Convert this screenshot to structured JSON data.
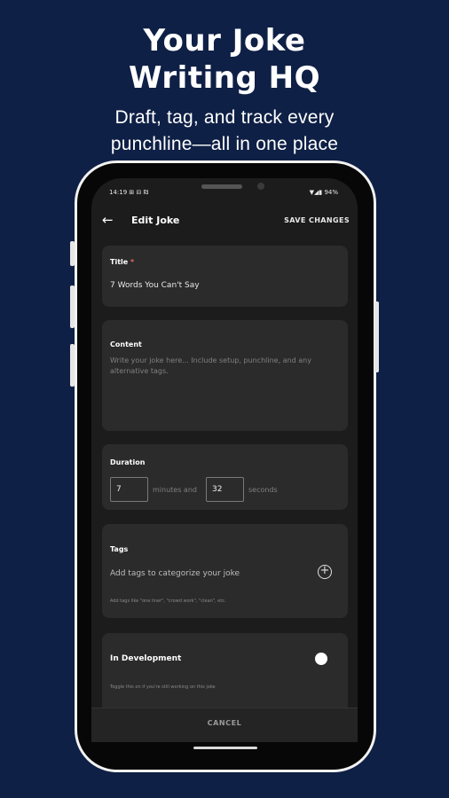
{
  "promo": {
    "headline_line1": "Your Joke",
    "headline_line2": "Writing HQ",
    "subline_line1": "Draft, tag, and track every",
    "subline_line2": "punchline—all in one place"
  },
  "status_bar": {
    "time": "14:19",
    "left_icons": "⊞ ⊟ ₪",
    "right_icons": "▼◢▮",
    "battery": "94%"
  },
  "app_bar": {
    "back_icon": "←",
    "title": "Edit Joke",
    "save_label": "SAVE CHANGES"
  },
  "form": {
    "title_label": "Title",
    "required_mark": "*",
    "title_value": "7 Words You Can't Say",
    "content_label": "Content",
    "content_placeholder": "Write your joke here... Include setup, punchline, and any alternative tags.",
    "duration_label": "Duration",
    "minutes_value": "7",
    "minutes_text": "minutes and",
    "seconds_value": "32",
    "seconds_text": "seconds",
    "tags_label": "Tags",
    "tags_placeholder": "Add tags to categorize your joke",
    "tags_hint": "Add tags like \"one liner\", \"crowd work\", \"clean\", etc.",
    "add_icon": "+",
    "dev_label": "In Development",
    "dev_hint": "Toggle this on if you're still working on this joke",
    "dev_on": true
  },
  "bottom": {
    "cancel_label": "CANCEL"
  },
  "colors": {
    "background": "#0f2046",
    "screen": "#1c1c1c",
    "card": "#2b2b2b",
    "required": "#e06b5e"
  }
}
